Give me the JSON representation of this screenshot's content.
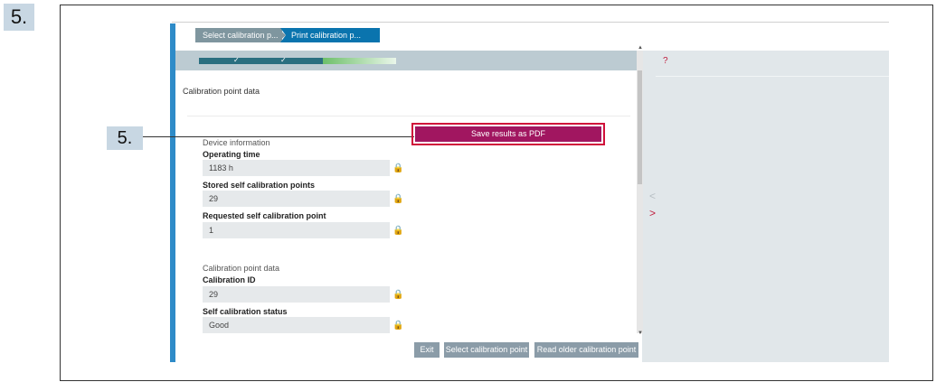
{
  "step_badge": "5.",
  "callout_label": "5.",
  "breadcrumb": {
    "step1": "Select calibration p...",
    "step2": "Print calibration p..."
  },
  "progress": {
    "completed_steps": 2,
    "total_steps": 3,
    "check_mark": "✓"
  },
  "page_title": "Calibration point data",
  "help": {
    "question_mark": "?",
    "prev_glyph": "<",
    "next_glyph": ">"
  },
  "save_button": "Save results as PDF",
  "device_info": {
    "section_label": "Device information",
    "operating_time_label": "Operating time",
    "operating_time_value": "1183 h",
    "stored_points_label": "Stored self calibration points",
    "stored_points_value": "29",
    "requested_point_label": "Requested self calibration point",
    "requested_point_value": "1"
  },
  "calibration_data": {
    "section_label": "Calibration point data",
    "calibration_id_label": "Calibration ID",
    "calibration_id_value": "29",
    "status_label": "Self calibration status",
    "status_value": "Good"
  },
  "lock_glyph": "🔒",
  "buttons": {
    "exit": "Exit",
    "select_point": "Select calibration point",
    "read_older": "Read older calibration point"
  },
  "colors": {
    "accent": "#a11660",
    "highlight": "#d0103a",
    "blue": "#0a74ae",
    "strip": "#2e8bc8"
  }
}
